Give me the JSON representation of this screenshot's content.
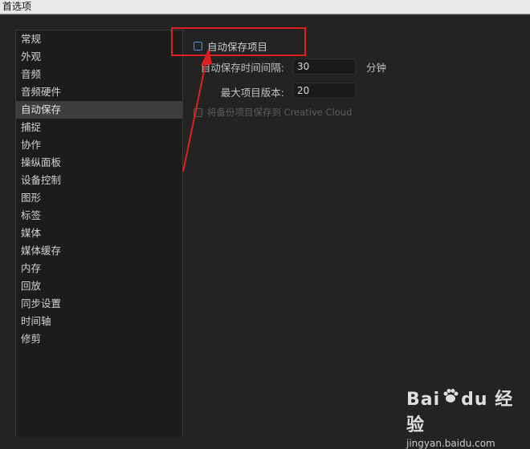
{
  "window": {
    "title": "首选项"
  },
  "sidebar": {
    "items": [
      {
        "label": "常规"
      },
      {
        "label": "外观"
      },
      {
        "label": "音频"
      },
      {
        "label": "音频硬件"
      },
      {
        "label": "自动保存",
        "selected": true
      },
      {
        "label": "捕捉"
      },
      {
        "label": "协作"
      },
      {
        "label": "操纵面板"
      },
      {
        "label": "设备控制"
      },
      {
        "label": "图形"
      },
      {
        "label": "标签"
      },
      {
        "label": "媒体"
      },
      {
        "label": "媒体缓存"
      },
      {
        "label": "内存"
      },
      {
        "label": "回放"
      },
      {
        "label": "同步设置"
      },
      {
        "label": "时间轴"
      },
      {
        "label": "修剪"
      }
    ]
  },
  "autosave": {
    "enable_label": "自动保存项目",
    "interval_label": "自动保存时间间隔:",
    "interval_value": "30",
    "interval_unit": "分钟",
    "max_versions_label": "最大项目版本:",
    "max_versions_value": "20",
    "cloud_label": "将备份项目保存到 Creative Cloud"
  },
  "annotation": {
    "color": "#e02020"
  },
  "watermark": {
    "brand": "Bai",
    "brand2": "du",
    "suffix": "经验",
    "url": "jingyan.baidu.com"
  },
  "colors": {
    "accent": "#4a8ee0",
    "selected_bg": "#3d3d3d",
    "panel_bg": "#1c1c1c"
  }
}
